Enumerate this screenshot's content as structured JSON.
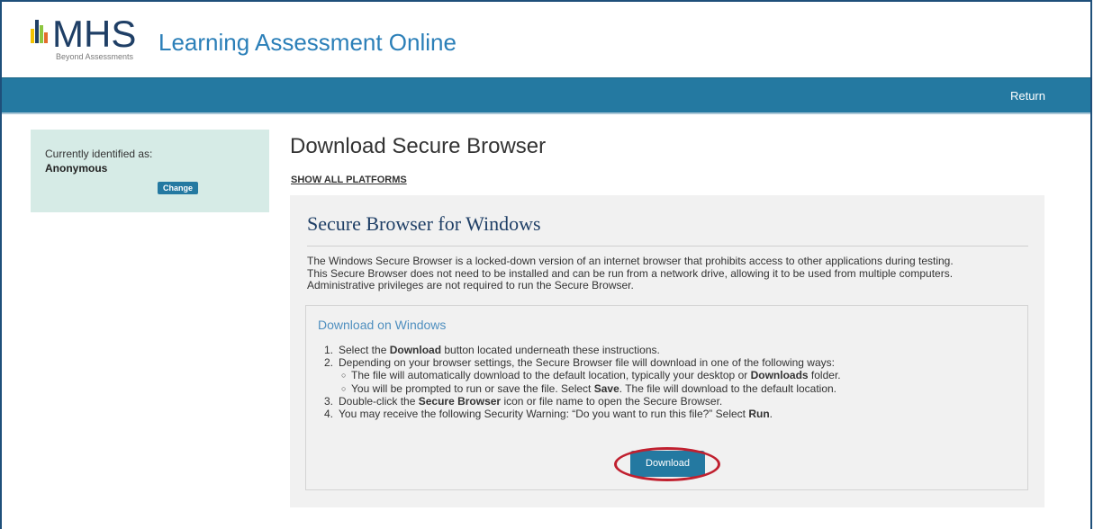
{
  "header": {
    "logo_text": "MHS",
    "logo_tagline": "Beyond Assessments",
    "app_title": "Learning Assessment Online"
  },
  "nav": {
    "return_label": "Return"
  },
  "identity": {
    "label": "Currently identified as:",
    "name": "Anonymous",
    "change_label": "Change"
  },
  "main": {
    "title": "Download Secure Browser",
    "show_all_label": "SHOW ALL PLATFORMS",
    "card": {
      "title": "Secure Browser for Windows",
      "description_lines": [
        "The Windows Secure Browser is a locked-down version of an internet browser that prohibits access to other applications during testing.",
        "This Secure Browser does not need to be installed and can be run from a network drive, allowing it to be used from multiple computers.",
        "Administrative privileges are not required to run the Secure Browser."
      ],
      "section_title": "Download on Windows",
      "steps": {
        "s1": {
          "num": "1.",
          "pre": "Select the ",
          "bold": "Download",
          "post": " button located underneath these instructions."
        },
        "s2": {
          "num": "2.",
          "text": "Depending on your browser settings, the Secure Browser file will download in one of the following ways:"
        },
        "s2a": {
          "pre": "The file will automatically download to the default location, typically your desktop or ",
          "bold": "Downloads",
          "post": " folder."
        },
        "s2b": {
          "pre": "You will be prompted to run or save the file. Select ",
          "bold": "Save",
          "post": ". The file will download to the default location."
        },
        "s3": {
          "num": "3.",
          "pre": "Double-click the ",
          "bold": "Secure Browser",
          "post": " icon or file name to open the Secure Browser."
        },
        "s4": {
          "num": "4.",
          "pre": "You may receive the following Security Warning: “Do you want to run this file?” Select ",
          "bold": "Run",
          "post": "."
        }
      },
      "download_label": "Download"
    }
  },
  "colors": {
    "nav_bar": "#2479a1",
    "identity_panel": "#d6ebe6",
    "title_blue": "#2b7fb8",
    "highlight_ring": "#c0202f",
    "logo_bars": [
      "#f2c200",
      "#2b7fb8",
      "#8dc63f",
      "#e36c2c"
    ]
  }
}
